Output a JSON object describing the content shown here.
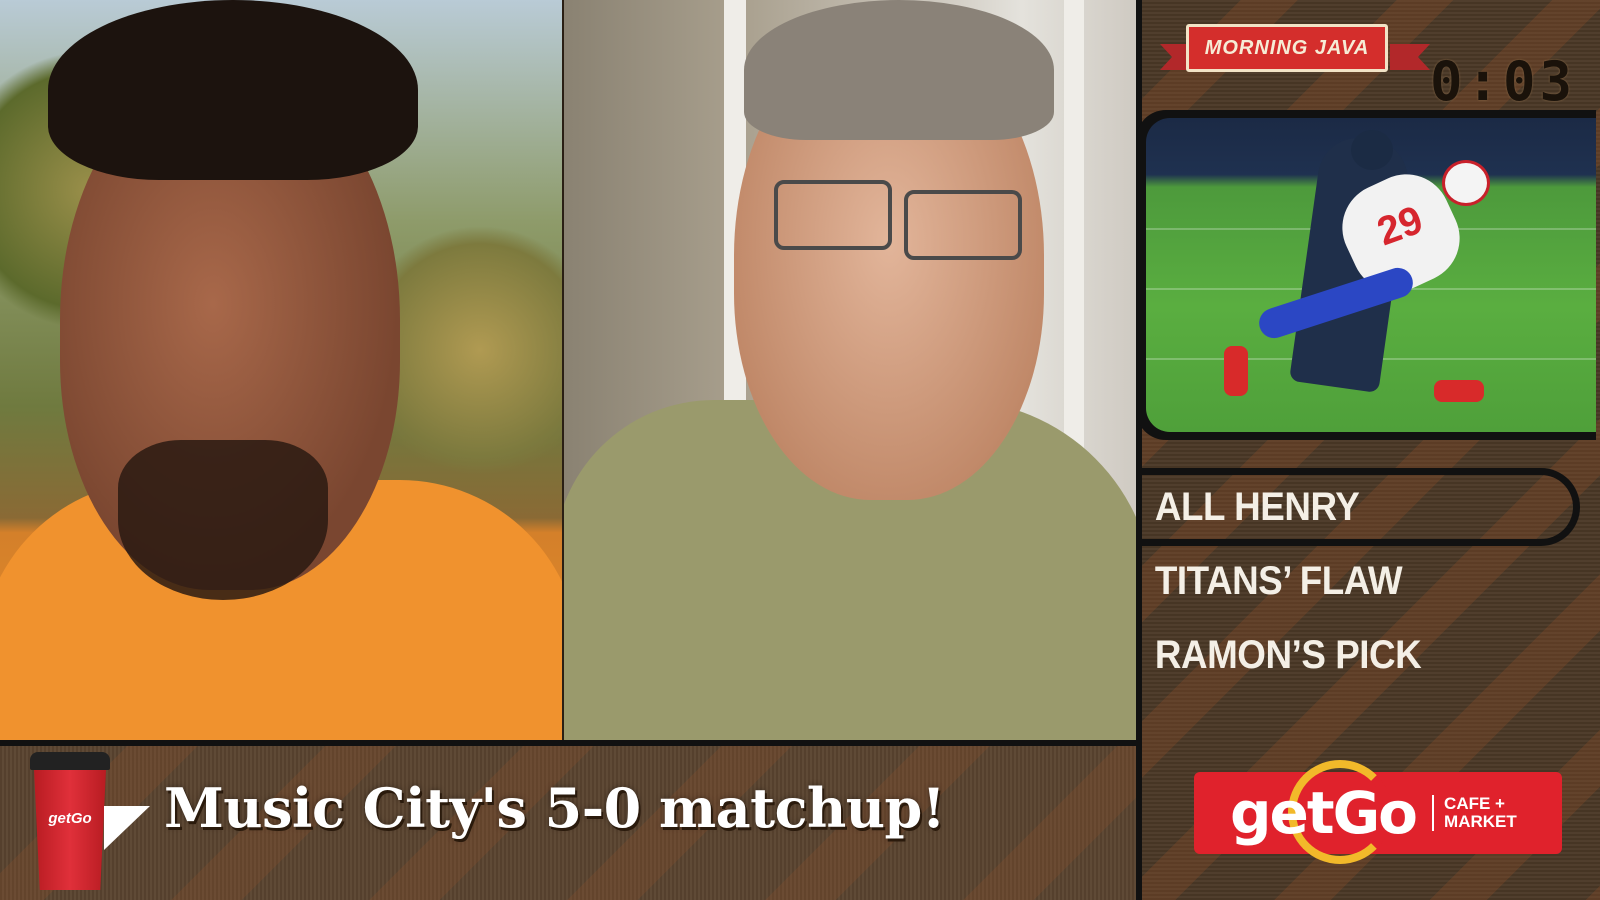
{
  "show": {
    "badge": "MORNING JAVA",
    "timer": "0:03"
  },
  "topics": [
    {
      "label": "ALL HENRY",
      "active": true
    },
    {
      "label": "TITANS’ FLAW",
      "active": false
    },
    {
      "label": "RAMON’S PICK",
      "active": false
    }
  ],
  "lower_third": {
    "headline": "Music City's 5-0 matchup!",
    "cup_logo": "getGo"
  },
  "sponsor": {
    "name": "getGo",
    "sub_line1": "CAFE +",
    "sub_line2": "MARKET"
  },
  "photo": {
    "jersey_number": "29"
  },
  "colors": {
    "badge_red": "#d42e2c",
    "sponsor_red": "#e0222c",
    "panel_brown": "#4a3826",
    "text_light": "#f4efe6"
  }
}
